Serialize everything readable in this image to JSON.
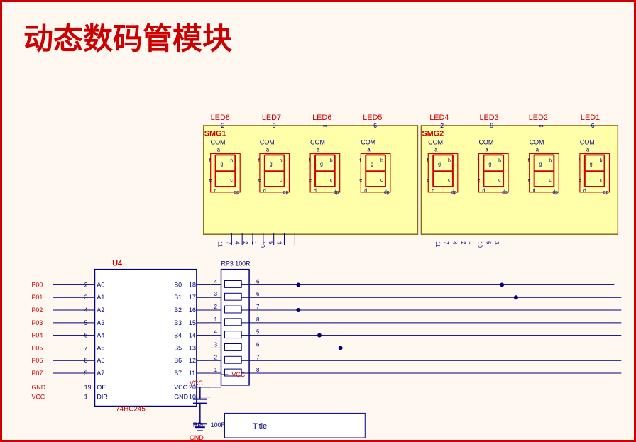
{
  "title": "动态数码管模块",
  "labels": {
    "led8": "LED8",
    "led7": "LED7",
    "led6": "LED6",
    "led5": "LED5",
    "led4": "LED4",
    "led3": "LED3",
    "led2": "LED2",
    "led1": "LED1",
    "smg1": "SMG1",
    "smg2": "SMG2",
    "com": "COM",
    "u4": "U4",
    "ic": "74HC245",
    "rp3": "RP3",
    "rp3val": "100R",
    "rp4": "RP4",
    "rp4val": "100R",
    "vcc": "VCC",
    "gnd": "GND",
    "title_box": "Title",
    "oe": "OE",
    "dir": "DIR",
    "ports": [
      "P00",
      "P01",
      "P02",
      "P03",
      "P04",
      "P05",
      "P06",
      "P07"
    ],
    "port_nums": [
      "2",
      "3",
      "4",
      "5",
      "6",
      "7",
      "8",
      "9"
    ],
    "a_ports": [
      "A0",
      "A1",
      "A2",
      "A3",
      "A4",
      "A5",
      "A6",
      "A7"
    ],
    "b_ports": [
      "B0",
      "B1",
      "B2",
      "B3",
      "B4",
      "B5",
      "B6",
      "B7"
    ],
    "left_nums": [
      "18",
      "17",
      "16",
      "15",
      "14",
      "13",
      "12",
      "11"
    ],
    "right_nums": [
      "4",
      "3",
      "2",
      "1",
      "4",
      "3",
      "2",
      "1"
    ],
    "seg_labels": [
      "a",
      "b",
      "c",
      "d",
      "e",
      "f",
      "g",
      "dp"
    ]
  }
}
